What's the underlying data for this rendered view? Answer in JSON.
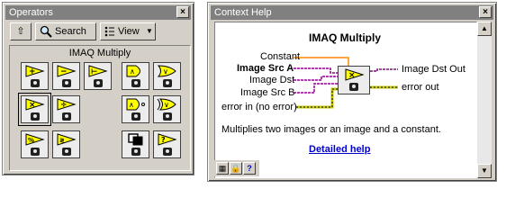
{
  "operators_window": {
    "title": "Operators",
    "up_button_label": "⇧",
    "search_label": "Search",
    "view_label": "View",
    "palette_title": "IMAQ Multiply",
    "items": [
      {
        "name": "add"
      },
      {
        "name": "subtract"
      },
      {
        "name": "subtract-constant"
      },
      {
        "name": "and"
      },
      {
        "name": "or"
      },
      {
        "name": "multiply"
      },
      {
        "name": "divide"
      },
      {
        "name": "nand"
      },
      {
        "name": "xor"
      },
      {
        "name": "modulo"
      },
      {
        "name": "compare"
      },
      {
        "name": "mask"
      },
      {
        "name": "logic-diff"
      }
    ]
  },
  "context_help": {
    "title": "Context Help",
    "function_title": "IMAQ Multiply",
    "inputs": {
      "constant": "Constant",
      "image_src_a": "Image Src A",
      "image_dst": "Image Dst",
      "image_src_b": "Image Src B",
      "error_in": "error in (no error)"
    },
    "outputs": {
      "image_dst_out": "Image Dst Out",
      "error_out": "error out"
    },
    "description": "Multiplies two images or an image and a constant.",
    "link_label": "Detailed help",
    "colors": {
      "wire_image": "#8b008b",
      "wire_error": "#c8c800",
      "wire_constant": "#ff8c00",
      "link": "#0000cc",
      "icon_yellow": "#ffff00"
    }
  }
}
